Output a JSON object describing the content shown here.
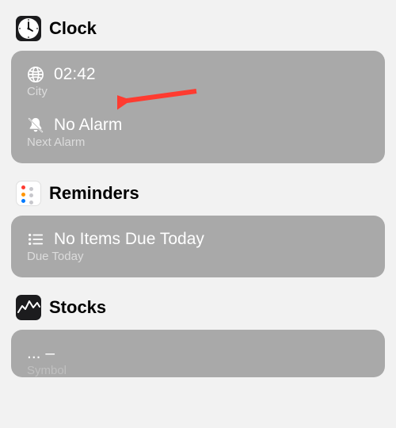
{
  "sections": {
    "clock": {
      "title": "Clock",
      "time": {
        "value": "02:42",
        "label": "City"
      },
      "alarm": {
        "value": "No Alarm",
        "label": "Next Alarm"
      }
    },
    "reminders": {
      "title": "Reminders",
      "due": {
        "value": "No Items Due Today",
        "label": "Due Today"
      }
    },
    "stocks": {
      "title": "Stocks",
      "symbol": {
        "value": "... –",
        "label": "Symbol"
      }
    }
  },
  "annotation": {
    "arrow_color": "#ff3b30",
    "target": "clock-time"
  }
}
